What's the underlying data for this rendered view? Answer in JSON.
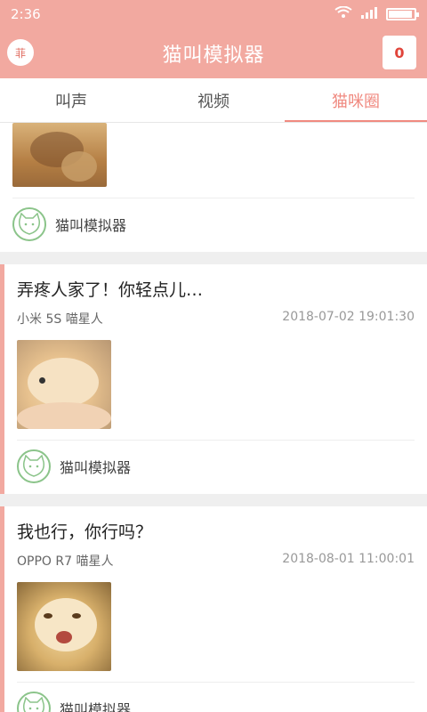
{
  "status": {
    "time": "2:36"
  },
  "appbar": {
    "title": "猫叫模拟器",
    "left_badge": "菲",
    "count": "0"
  },
  "tabs": [
    {
      "label": "叫声",
      "active": false
    },
    {
      "label": "视频",
      "active": false
    },
    {
      "label": "猫咪圈",
      "active": true
    }
  ],
  "feed": {
    "top_card": {
      "author": "猫叫模拟器"
    },
    "posts": [
      {
        "title": "弄疼人家了！你轻点儿…",
        "device": "小米 5S 喵星人",
        "time": "2018-07-02 19:01:30",
        "author": "猫叫模拟器"
      },
      {
        "title": "我也行，你行吗？",
        "device": "OPPO R7 喵星人",
        "time": "2018-08-01 11:00:01",
        "author": "猫叫模拟器"
      }
    ]
  },
  "colors": {
    "accent": "#f2a9a0",
    "active_tab": "#f08a80",
    "badge_text": "#e0443a"
  }
}
